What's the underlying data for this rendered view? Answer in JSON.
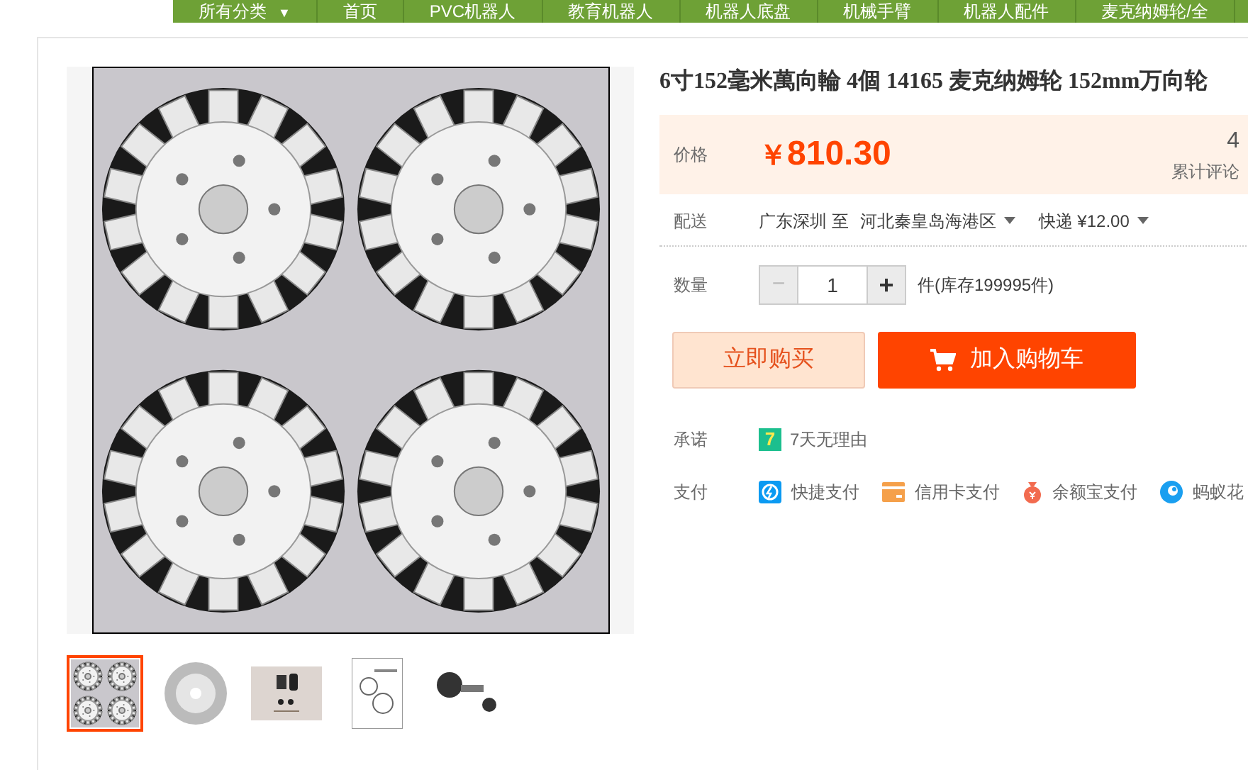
{
  "nav": [
    {
      "label": "所有分类",
      "caret": "▼"
    },
    {
      "label": "首页"
    },
    {
      "label": "PVC机器人"
    },
    {
      "label": "教育机器人"
    },
    {
      "label": "机器人底盘"
    },
    {
      "label": "机械手臂"
    },
    {
      "label": "机器人配件"
    },
    {
      "label": "麦克纳姆轮/全"
    }
  ],
  "title": "6寸152毫米萬向輪 4個 14165 麦克纳姆轮 152mm万向轮",
  "price": {
    "label": "价格",
    "currency": "￥",
    "amount": "810.30",
    "reviews_count": "4",
    "reviews_label": "累计评论"
  },
  "delivery": {
    "label": "配送",
    "from": "广东深圳 至",
    "to": "河北秦皇岛海港区",
    "method": "快递 ¥12.00"
  },
  "quantity": {
    "label": "数量",
    "minus": "−",
    "value": "1",
    "plus": "+",
    "stock": "件(库存199995件)"
  },
  "buttons": {
    "buy_now": "立即购买",
    "add_to_cart": "加入购物车"
  },
  "promise": {
    "label": "承诺",
    "badge": "7",
    "text": "7天无理由"
  },
  "payment": {
    "label": "支付",
    "methods": [
      {
        "kind": "quick",
        "label": "快捷支付"
      },
      {
        "kind": "card",
        "label": "信用卡支付"
      },
      {
        "kind": "yuebao",
        "label": "余额宝支付"
      },
      {
        "kind": "huabei",
        "label": "蚂蚁花"
      }
    ]
  },
  "thumbnails": [
    {
      "kind": "grid",
      "selected": true
    },
    {
      "kind": "wheel",
      "selected": false
    },
    {
      "kind": "parts",
      "selected": false
    },
    {
      "kind": "doc",
      "selected": false
    },
    {
      "kind": "assembly",
      "selected": false
    }
  ]
}
